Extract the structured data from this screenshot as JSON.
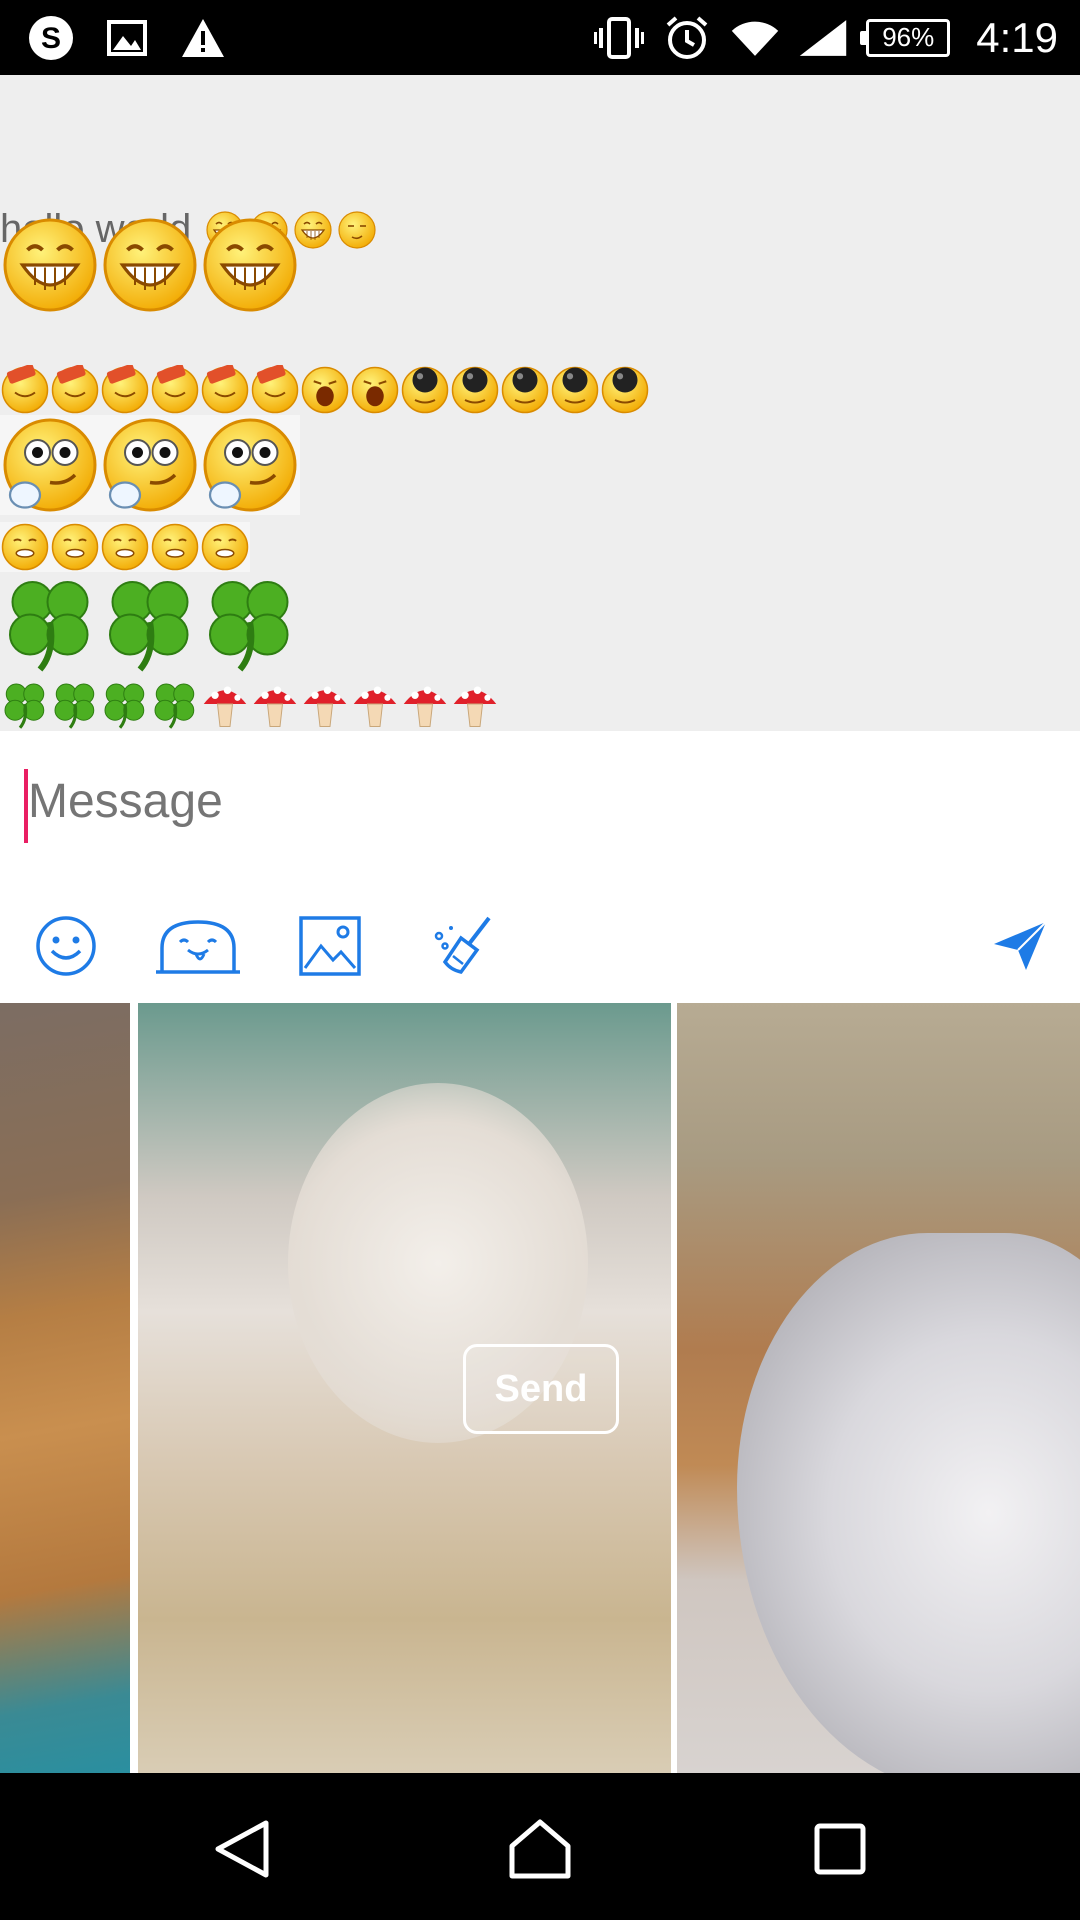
{
  "status_bar": {
    "left_icons": [
      "skype-icon",
      "image-icon",
      "warning-icon"
    ],
    "right_icons": [
      "vibrate-icon",
      "alarm-icon",
      "wifi-icon",
      "signal-icon"
    ],
    "battery": "96%",
    "time": "4:19"
  },
  "chat": {
    "message_text": "hello world",
    "emoji_rows": [
      {
        "name": "text-row-emoji",
        "items": [
          "grin-emoji",
          "grin-emoji",
          "grin-emoji",
          "sleepy-emoji"
        ]
      },
      {
        "name": "big-grin-row",
        "items": [
          "grin-emoji",
          "grin-emoji",
          "grin-emoji"
        ]
      },
      {
        "name": "mixed-row",
        "items": [
          "hammer-emoji",
          "hammer-emoji",
          "hammer-emoji",
          "hammer-emoji",
          "hammer-emoji",
          "hammer-emoji",
          "yawn-emoji",
          "yawn-emoji",
          "bomb-emoji",
          "bomb-emoji",
          "bomb-emoji",
          "bomb-emoji",
          "bomb-emoji"
        ]
      },
      {
        "name": "shy-row",
        "items": [
          "shy-emoji",
          "shy-emoji",
          "shy-emoji"
        ]
      },
      {
        "name": "smile-row",
        "items": [
          "content-emoji",
          "content-emoji",
          "content-emoji",
          "content-emoji",
          "content-emoji"
        ]
      },
      {
        "name": "big-clover-row",
        "items": [
          "clover-emoji",
          "clover-emoji",
          "clover-emoji"
        ]
      },
      {
        "name": "clover-mushroom-row",
        "items": [
          "clover-emoji",
          "clover-emoji",
          "clover-emoji",
          "clover-emoji",
          "mushroom-emoji",
          "mushroom-emoji",
          "mushroom-emoji",
          "mushroom-emoji",
          "mushroom-emoji",
          "mushroom-emoji"
        ]
      }
    ]
  },
  "compose": {
    "placeholder": "Message",
    "toolbar": [
      "smiley-icon",
      "sticker-icon",
      "gallery-icon",
      "broom-icon",
      "send-arrow-icon"
    ]
  },
  "gallery": {
    "send_label": "Send"
  },
  "nav_bar": {
    "buttons": [
      "back-icon",
      "home-icon",
      "recents-icon"
    ]
  },
  "colors": {
    "accent": "#1e7be6",
    "caret": "#e91e63",
    "chat_bg": "#eeeeee"
  }
}
